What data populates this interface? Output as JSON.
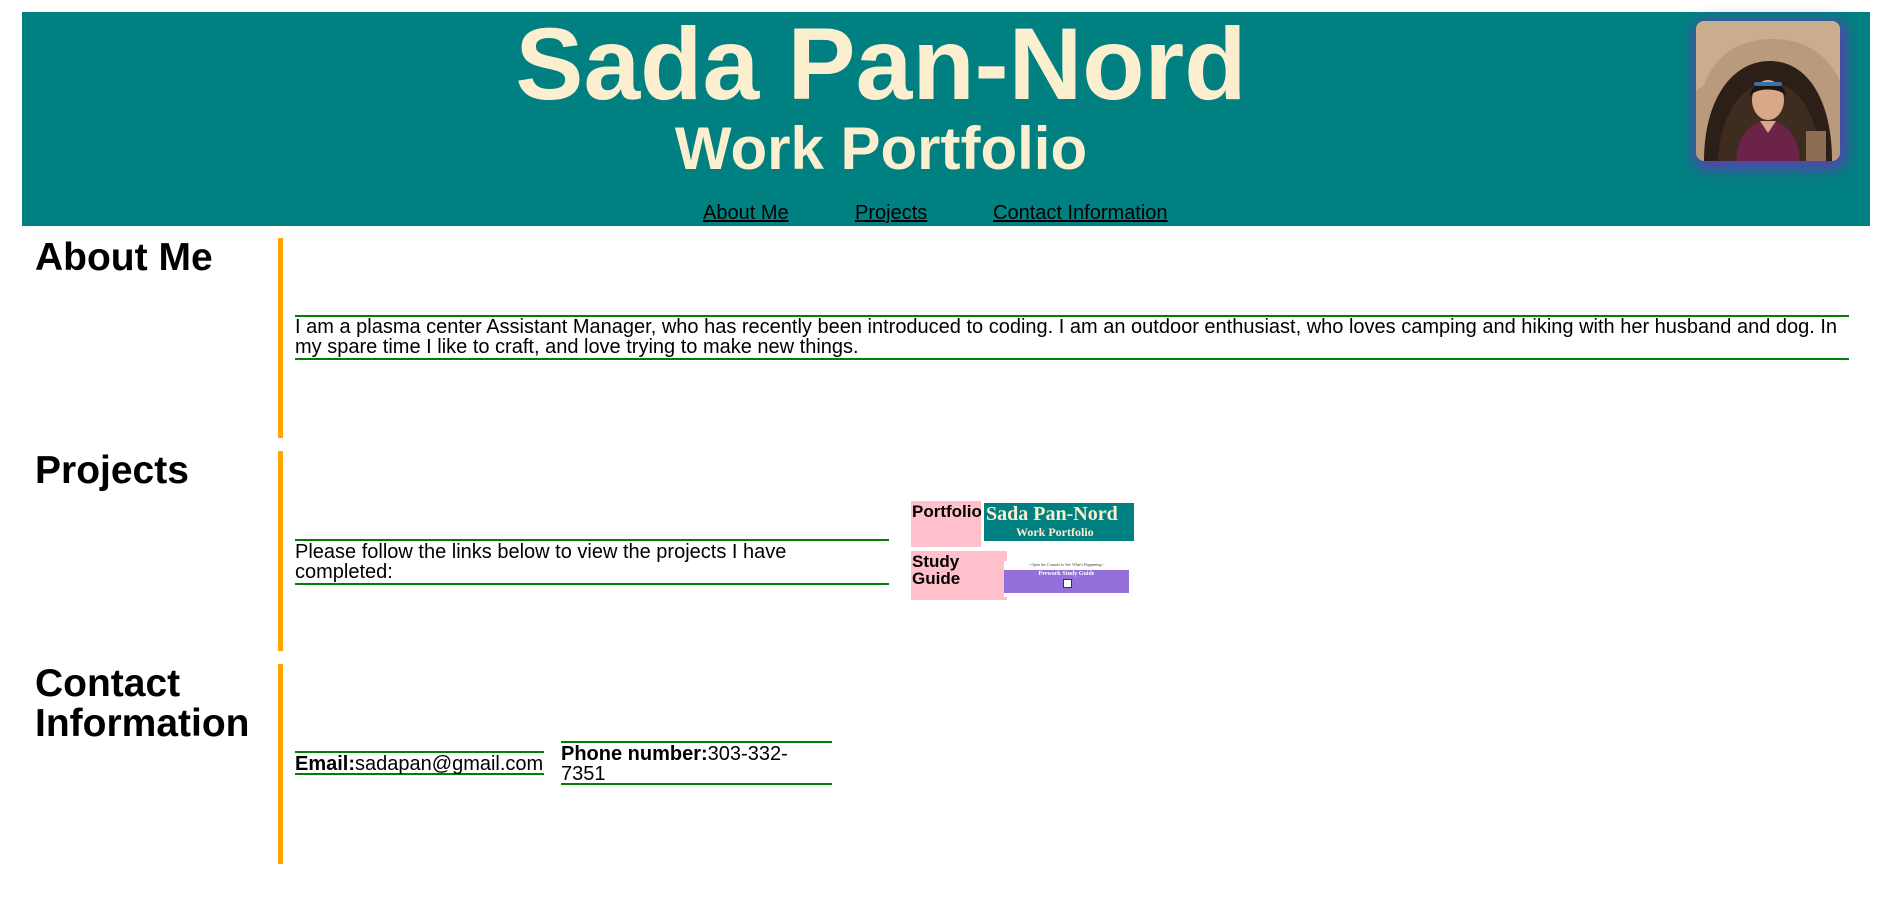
{
  "header": {
    "title": "Sada Pan-Nord",
    "subtitle": "Work Portfolio",
    "avatar_icon": "profile-photo",
    "colors": {
      "background": "#008080",
      "title_text": "#fbefcf",
      "avatar_glow": "#5b3fb0"
    }
  },
  "nav": {
    "items": [
      {
        "label": "About Me"
      },
      {
        "label": "Projects"
      },
      {
        "label": "Contact Information"
      }
    ]
  },
  "about": {
    "heading": "About Me",
    "text": "I am a plasma center Assistant Manager, who has recently been introduced to coding. I am an outdoor enthusiast, who loves camping and hiking with her husband and dog. In my spare time I like to craft, and love trying to make new things."
  },
  "projects": {
    "heading": "Projects",
    "intro": "Please follow the links below to view the projects I have completed:",
    "items": [
      {
        "label": "Portfolio",
        "thumbnail": {
          "title": "Sada Pan-Nord",
          "subtitle": "Work Portfolio"
        }
      },
      {
        "label": "Study Guide",
        "thumbnail": {
          "caption": "~ Open the Console to See What's Happening ~",
          "title": "Prework Study Guide"
        }
      }
    ]
  },
  "contact": {
    "heading": "Contact Information",
    "email_label": "Email:",
    "email_value": "sadapan@gmail.com",
    "phone_label": "Phone number:",
    "phone_value": "303-332-7351"
  },
  "colors": {
    "section_bar": "#ffa500",
    "text_rule": "#008000",
    "project_label_bg": "#ffc0cb",
    "study_guide_box": "#9370db"
  }
}
